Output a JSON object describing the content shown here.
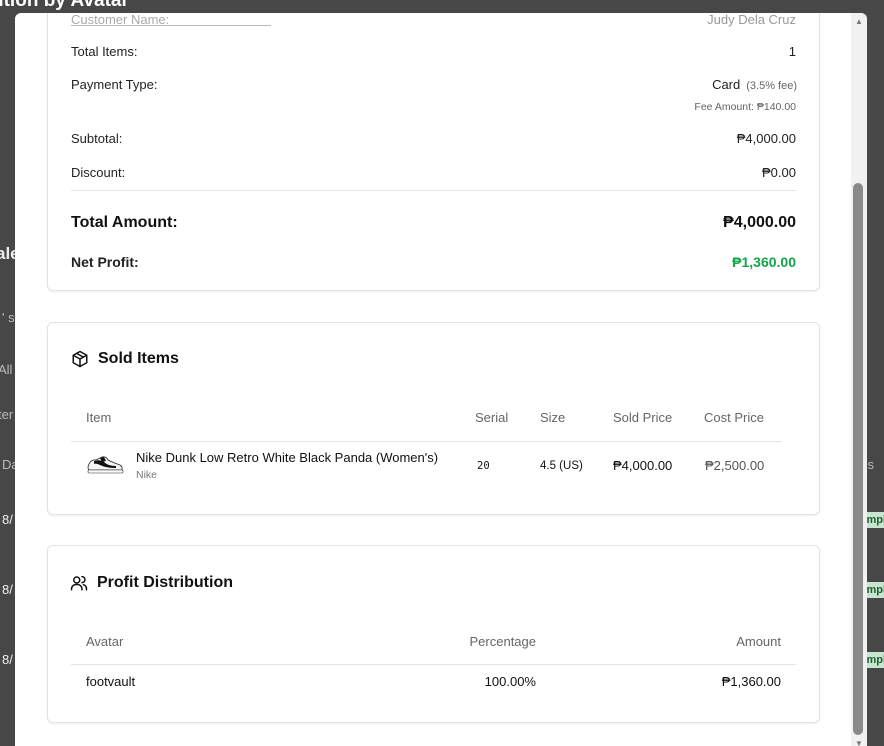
{
  "background": {
    "title": "ution by Avatar",
    "sales_heading": "ale",
    "search_fragment": "' sa",
    "filter_fragment": "All",
    "filter2_fragment": "ter",
    "date_col_fragment": "Da",
    "status_col_fragment": "us",
    "row_dates": [
      "8/",
      "8/",
      "8/"
    ],
    "row_status": [
      "mpl",
      "mpl",
      "mpl"
    ]
  },
  "summary": {
    "cut_label": "Customer Name:",
    "cut_value": "Judy Dela Cruz",
    "total_items_label": "Total Items:",
    "total_items_value": "1",
    "payment_type_label": "Payment Type:",
    "payment_type_value": "Card",
    "payment_fee_note": "(3.5% fee)",
    "fee_amount": "Fee Amount: ₱140.00",
    "subtotal_label": "Subtotal:",
    "subtotal_value": "₱4,000.00",
    "discount_label": "Discount:",
    "discount_value": "₱0.00",
    "total_amount_label": "Total Amount:",
    "total_amount_value": "₱4,000.00",
    "net_profit_label": "Net Profit:",
    "net_profit_value": "₱1,360.00"
  },
  "sold_items": {
    "title": "Sold Items",
    "icon": "package-icon",
    "columns": [
      "Item",
      "Serial",
      "Size",
      "Sold Price",
      "Cost Price"
    ],
    "rows": [
      {
        "name": "Nike Dunk Low Retro White Black Panda (Women's)",
        "brand": "Nike",
        "serial": "20",
        "size": "4.5 (US)",
        "sold_price": "₱4,000.00",
        "cost_price": "₱2,500.00"
      }
    ]
  },
  "profit_distribution": {
    "title": "Profit Distribution",
    "icon": "users-icon",
    "columns": [
      "Avatar",
      "Percentage",
      "Amount"
    ],
    "rows": [
      {
        "avatar": "footvault",
        "percentage": "100.00%",
        "amount": "₱1,360.00"
      }
    ]
  },
  "colors": {
    "net_profit": "#16a34a",
    "overlay": "#000000"
  }
}
